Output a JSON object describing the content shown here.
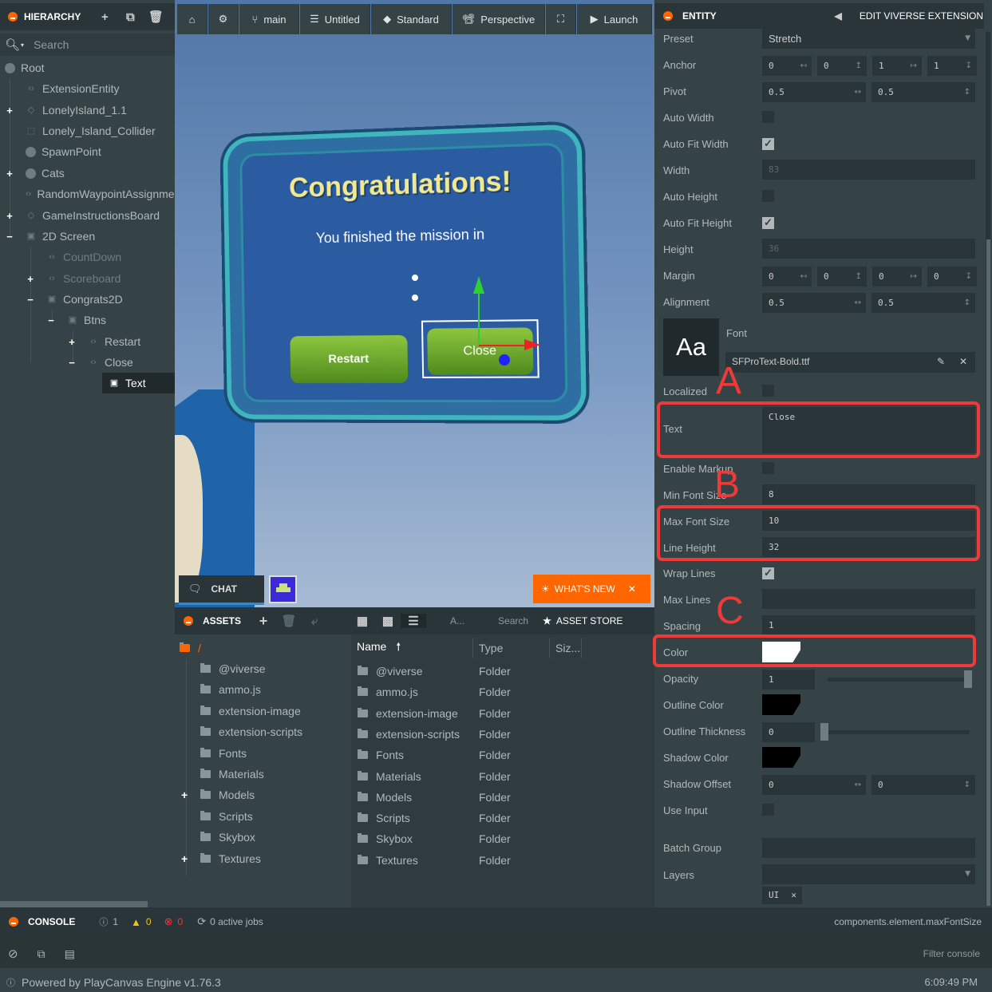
{
  "hierarchy": {
    "title": "HIERARCHY",
    "search_placeholder": "Search",
    "items": [
      {
        "label": "Root"
      },
      {
        "label": "ExtensionEntity"
      },
      {
        "label": "LonelyIsland_1.1"
      },
      {
        "label": "Lonely_Island_Collider"
      },
      {
        "label": "SpawnPoint"
      },
      {
        "label": "Cats"
      },
      {
        "label": "RandomWaypointAssignment"
      },
      {
        "label": "GameInstructionsBoard"
      },
      {
        "label": "2D Screen"
      },
      {
        "label": "CountDown"
      },
      {
        "label": "Scoreboard"
      },
      {
        "label": "Congrats2D"
      },
      {
        "label": "Btns"
      },
      {
        "label": "Restart"
      },
      {
        "label": "Close"
      },
      {
        "label": "Text"
      }
    ]
  },
  "toolbar": {
    "branch": "main",
    "scene": "Untitled",
    "render_mode": "Standard",
    "camera": "Perspective",
    "launch": "Launch"
  },
  "viewport": {
    "congrats_title": "Congratulations!",
    "congrats_msg": "You finished the mission in",
    "restart_btn": "Restart",
    "close_btn": "Close",
    "chat_label": "CHAT",
    "whats_new": "WHAT'S NEW"
  },
  "assets": {
    "title": "ASSETS",
    "filter_label": "A...",
    "search_placeholder": "Search",
    "store_label": "ASSET STORE",
    "root_path": "/",
    "col_name": "Name",
    "col_type": "Type",
    "col_size": "Siz...",
    "tree": [
      "@viverse",
      "ammo.js",
      "extension-image",
      "extension-scripts",
      "Fonts",
      "Materials",
      "Models",
      "Scripts",
      "Skybox",
      "Textures"
    ],
    "rows": [
      {
        "name": "@viverse",
        "type": "Folder"
      },
      {
        "name": "ammo.js",
        "type": "Folder"
      },
      {
        "name": "extension-image",
        "type": "Folder"
      },
      {
        "name": "extension-scripts",
        "type": "Folder"
      },
      {
        "name": "Fonts",
        "type": "Folder"
      },
      {
        "name": "Materials",
        "type": "Folder"
      },
      {
        "name": "Models",
        "type": "Folder"
      },
      {
        "name": "Scripts",
        "type": "Folder"
      },
      {
        "name": "Skybox",
        "type": "Folder"
      },
      {
        "name": "Textures",
        "type": "Folder"
      }
    ]
  },
  "inspector": {
    "title": "ENTITY",
    "edit_ext": "EDIT VIVERSE EXTENSION",
    "labels": {
      "preset": "Preset",
      "anchor": "Anchor",
      "pivot": "Pivot",
      "auto_width": "Auto Width",
      "auto_fit_width": "Auto Fit Width",
      "width": "Width",
      "auto_height": "Auto Height",
      "auto_fit_height": "Auto Fit Height",
      "height": "Height",
      "margin": "Margin",
      "alignment": "Alignment",
      "font": "Font",
      "localized": "Localized",
      "text": "Text",
      "enable_markup": "Enable Markup",
      "min_font_size": "Min Font Size",
      "max_font_size": "Max Font Size",
      "line_height": "Line Height",
      "wrap_lines": "Wrap Lines",
      "max_lines": "Max Lines",
      "spacing": "Spacing",
      "color": "Color",
      "opacity": "Opacity",
      "outline_color": "Outline Color",
      "outline_thickness": "Outline Thickness",
      "shadow_color": "Shadow Color",
      "shadow_offset": "Shadow Offset",
      "use_input": "Use Input",
      "batch_group": "Batch Group",
      "layers": "Layers"
    },
    "values": {
      "preset": "Stretch",
      "anchor": [
        "0",
        "0",
        "1",
        "1"
      ],
      "pivot": [
        "0.5",
        "0.5"
      ],
      "width": "83",
      "height": "36",
      "margin": [
        "0",
        "0",
        "0",
        "0"
      ],
      "alignment": [
        "0.5",
        "0.5"
      ],
      "font_preview": "Aa",
      "font_file": "SFProText-Bold.ttf",
      "text": "Close",
      "min_font_size": "8",
      "max_font_size": "10",
      "line_height": "32",
      "spacing": "1",
      "opacity": "1",
      "outline_thickness": "0",
      "shadow_offset": [
        "0",
        "0"
      ],
      "layer_tag": "UI"
    },
    "annotations": [
      "A",
      "B",
      "C"
    ],
    "colors": {
      "color": "#ffffff",
      "outline": "#000000",
      "shadow": "#000000"
    }
  },
  "console": {
    "title": "CONSOLE",
    "info_count": "1",
    "warn_count": "0",
    "error_count": "0",
    "jobs": "0 active jobs",
    "path": "components.element.maxFontSize",
    "filter_placeholder": "Filter console"
  },
  "status": {
    "powered": "Powered by PlayCanvas Engine v1.76.3",
    "time": "6:09:49 PM"
  }
}
